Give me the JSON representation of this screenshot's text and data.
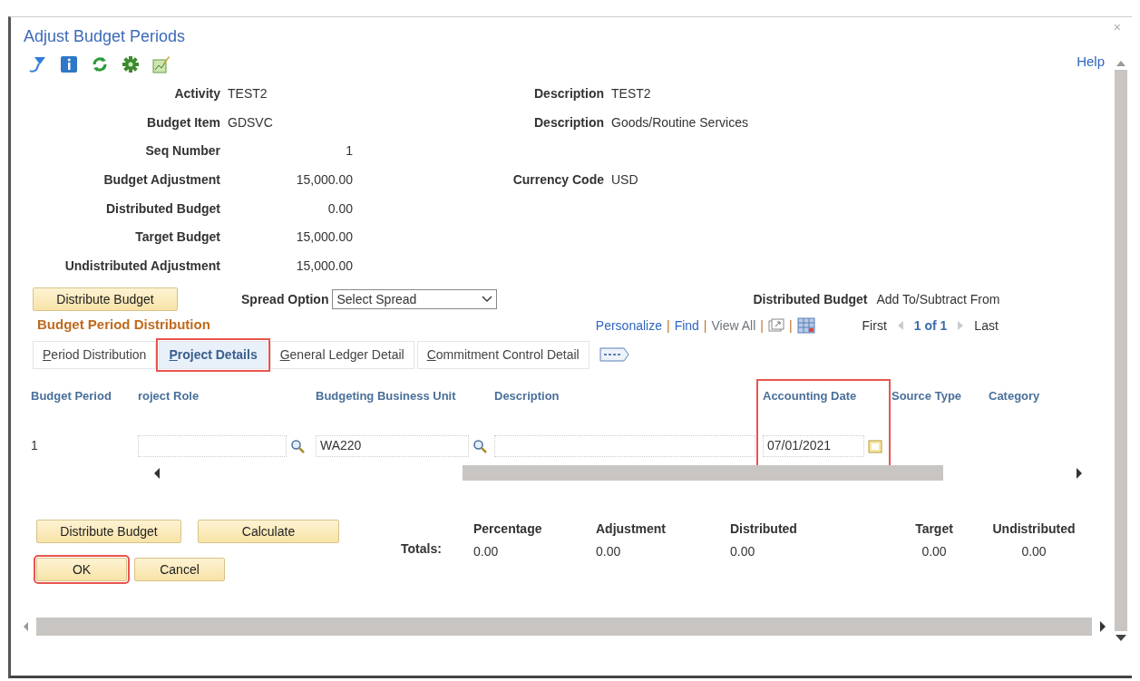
{
  "window": {
    "title": "Adjust Budget Periods",
    "help": "Help",
    "close": "×"
  },
  "fields": [
    {
      "label": "Activity",
      "value": "TEST2",
      "kind": "text",
      "right": {
        "label": "Description",
        "value": "TEST2"
      }
    },
    {
      "label": "Budget Item",
      "value": "GDSVC",
      "kind": "text",
      "right": {
        "label": "Description",
        "value": "Goods/Routine Services"
      }
    },
    {
      "label": "Seq Number",
      "value": "1",
      "kind": "amount"
    },
    {
      "label": "Budget Adjustment",
      "value": "15,000.00",
      "kind": "amount",
      "right": {
        "label": "Currency Code",
        "value": "USD"
      }
    },
    {
      "label": "Distributed Budget",
      "value": "0.00",
      "kind": "amount"
    },
    {
      "label": "Target Budget",
      "value": "15,000.00",
      "kind": "amount"
    },
    {
      "label": "Undistributed Adjustment",
      "value": "15,000.00",
      "kind": "amount"
    }
  ],
  "distribute_button": "Distribute Budget",
  "spread_option": {
    "label": "Spread Option",
    "value": "Select Spread"
  },
  "distributed_budget": {
    "label": "Distributed Budget",
    "value": "Add To/Subtract From"
  },
  "grid": {
    "title": "Budget Period Distribution",
    "links": [
      "Personalize",
      "Find",
      "View All"
    ],
    "separator": "|",
    "nav": {
      "first": "First",
      "count": "1 of 1",
      "last": "Last"
    },
    "tabs": [
      {
        "label": "Period Distribution",
        "selected": false,
        "highlighted": false
      },
      {
        "label": "Project Details",
        "selected": true,
        "highlighted": true
      },
      {
        "label": "General Ledger Detail",
        "selected": false,
        "highlighted": false
      },
      {
        "label": "Commitment Control Detail",
        "selected": false,
        "highlighted": false
      }
    ],
    "columns": [
      {
        "label": "Budget Period",
        "kind": "text",
        "highlighted": false
      },
      {
        "label": "roject Role",
        "kind": "lookup",
        "highlighted": false
      },
      {
        "label": "Budgeting Business Unit",
        "kind": "lookup",
        "highlighted": false
      },
      {
        "label": "Description",
        "kind": "input",
        "highlighted": false
      },
      {
        "label": "Accounting Date",
        "kind": "date",
        "highlighted": true
      },
      {
        "label": "Source Type",
        "kind": "none",
        "highlighted": false
      },
      {
        "label": "Category",
        "kind": "none",
        "highlighted": false
      }
    ],
    "rows": [
      {
        "cells": [
          "1",
          "",
          "WA220",
          "",
          "07/01/2021"
        ]
      }
    ]
  },
  "action_buttons": [
    {
      "label": "Distribute Budget"
    },
    {
      "label": "Calculate"
    }
  ],
  "totals": {
    "label": "Totals:",
    "items": [
      {
        "label": "Percentage",
        "value": "0.00"
      },
      {
        "label": "Adjustment",
        "value": "0.00"
      },
      {
        "label": "Distributed",
        "value": "0.00"
      },
      {
        "label": "Target",
        "value": "0.00"
      },
      {
        "label": "Undistributed",
        "value": "0.00"
      }
    ]
  },
  "footer_buttons": [
    {
      "label": "OK",
      "highlighted": true
    },
    {
      "label": "Cancel",
      "highlighted": false
    }
  ]
}
